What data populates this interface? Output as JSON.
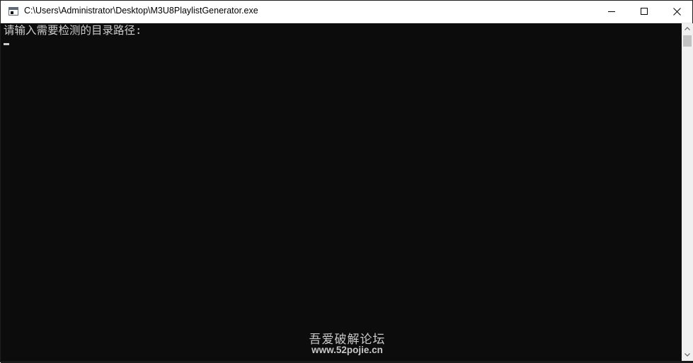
{
  "window": {
    "title": "C:\\Users\\Administrator\\Desktop\\M3U8PlaylistGenerator.exe",
    "icon": "console-app-icon",
    "controls": {
      "minimize_icon": "minimize-icon",
      "maximize_icon": "maximize-icon",
      "close_icon": "close-icon"
    }
  },
  "console": {
    "prompt_line": "请输入需要检测的目录路径:",
    "background": "#0c0c0c",
    "foreground": "#cccccc"
  },
  "watermark": {
    "chinese": "吾爱破解论坛",
    "url": "www.52pojie.cn"
  }
}
